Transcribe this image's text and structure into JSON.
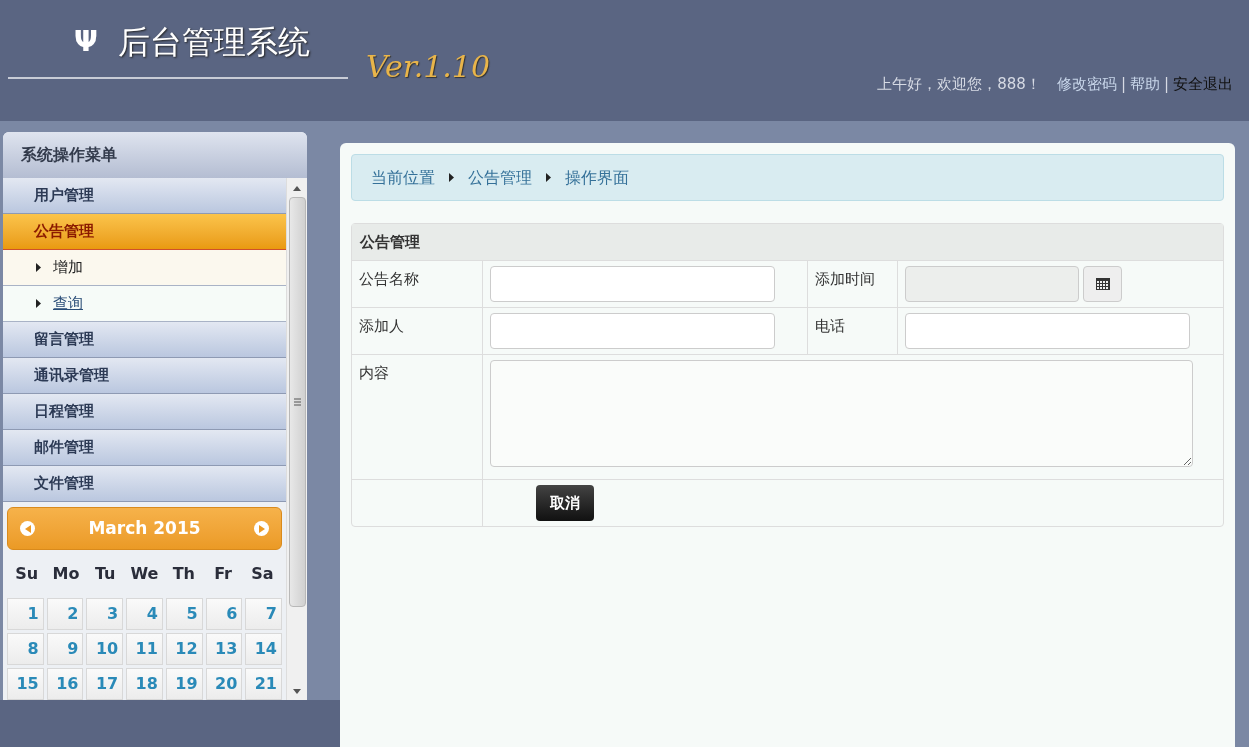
{
  "header": {
    "logo_glyph": "Ψ",
    "title": "后台管理系统",
    "version": "Ver.1.10",
    "greeting": "上午好，欢迎您，888！",
    "links": [
      {
        "label": "修改密码",
        "kind": "link"
      },
      {
        "label": "帮助",
        "kind": "link"
      },
      {
        "label": "安全退出",
        "kind": "exit"
      }
    ],
    "separator": "|"
  },
  "sidebar": {
    "title": "系统操作菜单",
    "items": [
      {
        "label": "用户管理",
        "selected": false
      },
      {
        "label": "公告管理",
        "selected": true,
        "children": [
          {
            "label": "增加",
            "selected": false
          },
          {
            "label": "查询",
            "selected": true
          }
        ]
      },
      {
        "label": "留言管理",
        "selected": false
      },
      {
        "label": "通讯录管理",
        "selected": false
      },
      {
        "label": "日程管理",
        "selected": false
      },
      {
        "label": "邮件管理",
        "selected": false
      },
      {
        "label": "文件管理",
        "selected": false
      }
    ]
  },
  "calendar": {
    "month": "March 2015",
    "weekdays": [
      "Su",
      "Mo",
      "Tu",
      "We",
      "Th",
      "Fr",
      "Sa"
    ],
    "weeks": [
      [
        "1",
        "2",
        "3",
        "4",
        "5",
        "6",
        "7"
      ],
      [
        "8",
        "9",
        "10",
        "11",
        "12",
        "13",
        "14"
      ],
      [
        "15",
        "16",
        "17",
        "18",
        "19",
        "20",
        "21"
      ]
    ]
  },
  "breadcrumb": [
    "当前位置",
    "公告管理",
    "操作界面"
  ],
  "form": {
    "title": "公告管理",
    "fields": [
      {
        "label": "公告名称",
        "kind": "text"
      },
      {
        "label": "添加时间",
        "kind": "date",
        "disabled": true
      },
      {
        "label": "添加人",
        "kind": "text"
      },
      {
        "label": "电话",
        "kind": "text"
      },
      {
        "label": "内容",
        "kind": "textarea"
      }
    ],
    "buttons": [
      "取消"
    ]
  }
}
